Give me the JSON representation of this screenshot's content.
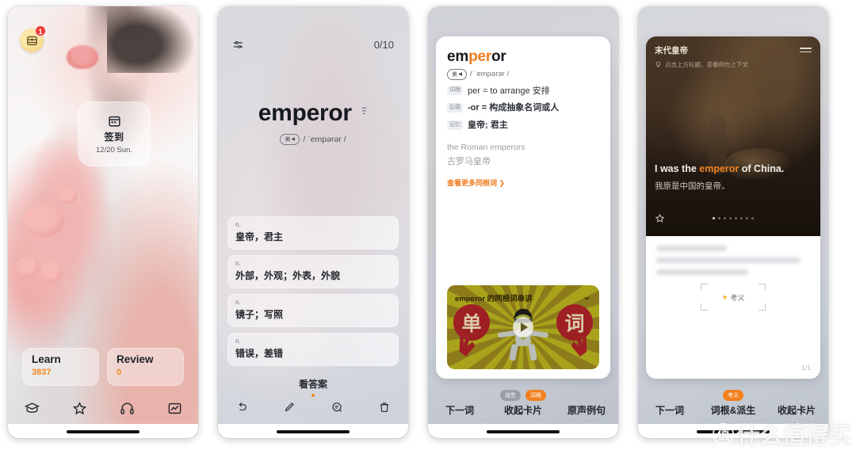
{
  "app": {
    "accent_orange": "#f08a25",
    "accent_red": "#ec3b33"
  },
  "panel_home": {
    "chest_badge_count": "1",
    "checkin": {
      "title": "签到",
      "date": "12/20 Sun."
    },
    "stats": [
      {
        "label": "Learn",
        "value": "3837"
      },
      {
        "label": "Review",
        "value": "0"
      }
    ],
    "tabs": [
      {
        "name": "learn",
        "icon": "graduation-cap-icon"
      },
      {
        "name": "favorites",
        "icon": "star-icon"
      },
      {
        "name": "listening",
        "icon": "headphones-icon"
      },
      {
        "name": "statistics",
        "icon": "chart-icon"
      }
    ]
  },
  "panel_quiz": {
    "progress": "0/10",
    "word": "emperor",
    "accent_label": "美",
    "phonetic": "/ ˈempərər /",
    "options": [
      {
        "pos": "n.",
        "text": "皇帝，君主"
      },
      {
        "pos": "n.",
        "text": "外部，外观；外表，外貌"
      },
      {
        "pos": "n.",
        "text": "镜子；写照"
      },
      {
        "pos": "n.",
        "text": "错误，差错"
      }
    ],
    "show_answer": "看答案",
    "tools": [
      {
        "name": "undo",
        "icon": "undo-icon"
      },
      {
        "name": "edit",
        "icon": "pencil-icon"
      },
      {
        "name": "comment",
        "icon": "comment-icon"
      },
      {
        "name": "delete",
        "icon": "trash-icon"
      }
    ]
  },
  "panel_dict": {
    "word_prefix": "em",
    "word_highlight": "per",
    "word_suffix": "or",
    "accent_label": "美",
    "phonetic": "/ ˈempərər /",
    "entries": [
      {
        "tag": "词根",
        "text": "per = to arrange 安排",
        "bold": false
      },
      {
        "tag": "后缀",
        "text": "-or = 构成抽象名词或人",
        "bold": true
      },
      {
        "tag": "记忆",
        "text": "皇帝; 君主",
        "bold": true
      }
    ],
    "example_en": "the Roman emperors",
    "example_cn": "古罗马皇帝",
    "more_link": "查看更多同根词 ❯",
    "video": {
      "title": "emperor 的同根词串讲",
      "left_char": "单",
      "right_char": "词"
    },
    "pills": [
      {
        "label": "派生",
        "style": "gray"
      },
      {
        "label": "词根",
        "style": "orange"
      }
    ],
    "tabs": [
      "下一词",
      "收起卡片",
      "原声例句"
    ]
  },
  "panel_sentence": {
    "hero_title": "末代皇帝",
    "hero_hint": "点击上方标题，查看例句上下文",
    "sentence_before": "I was the ",
    "sentence_highlight": "emperor",
    "sentence_after": " of China.",
    "sentence_cn": "我原是中国的皇帝。",
    "dots_total": 8,
    "dots_active": 1,
    "kaoyi_label": "考义",
    "page_indicator": "1/1",
    "pills": [
      {
        "label": "考义",
        "style": "orange"
      }
    ],
    "tabs": [
      "下一词",
      "词根&派生",
      "收起卡片"
    ]
  },
  "watermark": {
    "mark": "值",
    "text": "什么值得买"
  }
}
